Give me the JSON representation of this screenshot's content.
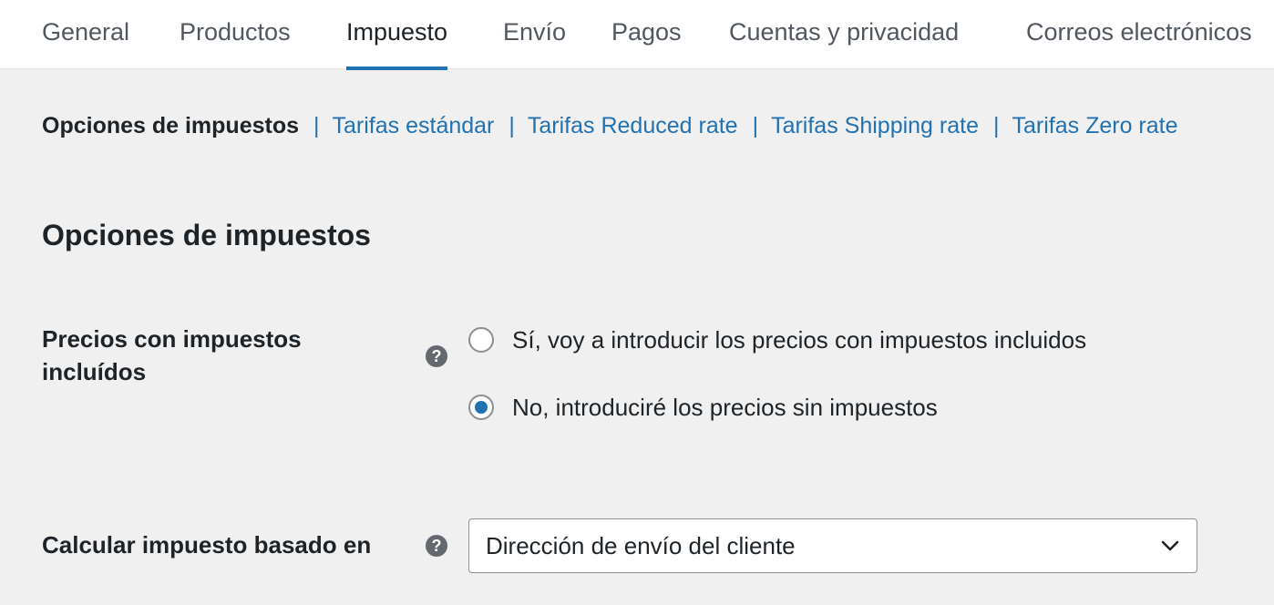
{
  "tabs": [
    {
      "label": "General",
      "active": false
    },
    {
      "label": "Productos",
      "active": false
    },
    {
      "label": "Impuesto",
      "active": true
    },
    {
      "label": "Envío",
      "active": false
    },
    {
      "label": "Pagos",
      "active": false
    },
    {
      "label": "Cuentas y privacidad",
      "active": false
    },
    {
      "label": "Correos electrónicos",
      "active": false
    }
  ],
  "subnav": {
    "current": "Opciones de impuestos",
    "separator": "|",
    "links": [
      "Tarifas estándar",
      "Tarifas Reduced rate",
      "Tarifas Shipping rate",
      "Tarifas Zero rate"
    ]
  },
  "section": {
    "title": "Opciones de impuestos"
  },
  "prices_include_tax": {
    "label": "Precios con impuestos incluídos",
    "help_glyph": "?",
    "options": [
      {
        "label": "Sí, voy a introducir los precios con impuestos incluidos",
        "checked": false
      },
      {
        "label": "No, introduciré los precios sin impuestos",
        "checked": true
      }
    ]
  },
  "tax_based_on": {
    "label": "Calcular impuesto basado en",
    "help_glyph": "?",
    "selected": "Dirección de envío del cliente"
  },
  "colors": {
    "accent": "#2271b1",
    "background": "#f0f0f1",
    "text": "#1d2327",
    "muted": "#50575e"
  }
}
